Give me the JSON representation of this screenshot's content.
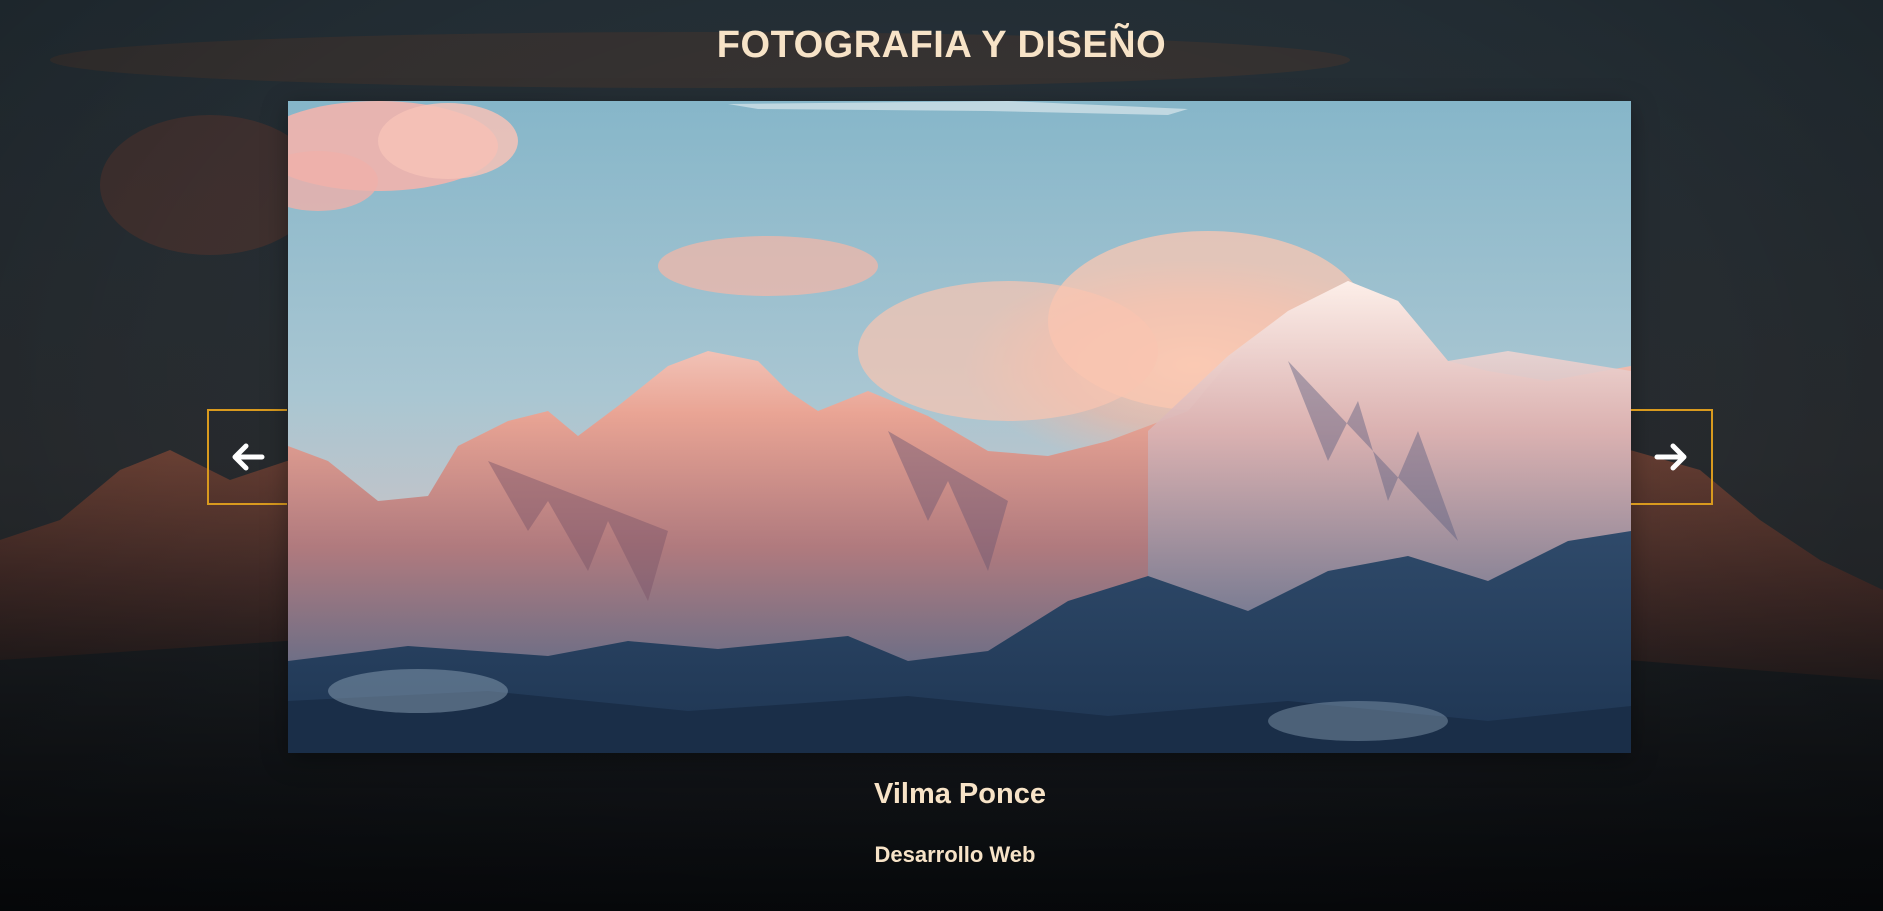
{
  "header": {
    "title": "FOTOGRAFIA Y DISEÑO"
  },
  "slider": {
    "image_alt": "mountain-sunset-photo",
    "prev_icon": "arrow-left-icon",
    "next_icon": "arrow-right-icon"
  },
  "caption": {
    "name": "Vilma Ponce",
    "role": "Desarrollo Web"
  },
  "colors": {
    "accent_border": "#d99a1e",
    "title_text": "#f7e3c7",
    "arrow": "#ffffff"
  }
}
